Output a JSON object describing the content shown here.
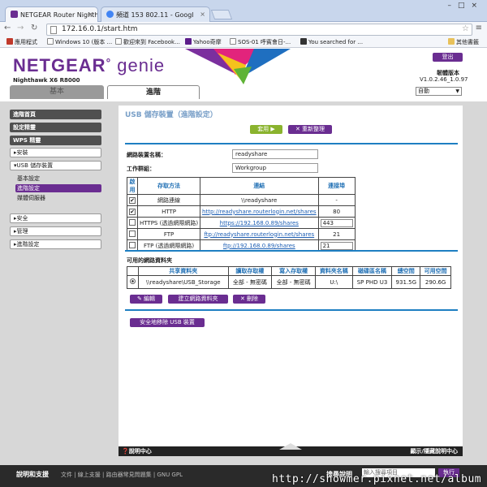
{
  "browser": {
    "tabs": [
      {
        "label": "NETGEAR Router Nighth",
        "active": true
      },
      {
        "label": "頻道 153 802.11 - Googl",
        "active": false
      }
    ],
    "url": "172.16.0.1/start.htm",
    "bookmarks": [
      "應用程式",
      "Windows 10 (版本 ...",
      "歡迎來到 Facebook...",
      "Yahoo奇摩",
      "SOS-01 呼賓會日-...",
      "You searched for ...",
      "其他書籤"
    ]
  },
  "header": {
    "brand": "NETGEAR",
    "product": "genie",
    "model": "Nighthawk X6 R8000",
    "logout_label": "登出",
    "firmware_label": "韌體版本",
    "firmware_version": "V1.0.2.46_1.0.97",
    "language": "自動"
  },
  "main_tabs": {
    "basic": "基本",
    "advanced": "進階"
  },
  "sidebar": {
    "dark_items": [
      "進階首頁",
      "設定精靈",
      "WPS 精靈"
    ],
    "setup": "▸安裝",
    "usb": "▾USB 儲存裝置",
    "usb_sub": [
      "基本設定",
      "進階設定",
      "媒體伺服器"
    ],
    "others": [
      "▸安全",
      "▸管理",
      "▸進階設定"
    ]
  },
  "panel": {
    "title": "USB 儲存裝置（進階設定）",
    "apply_label": "套用 ▶",
    "refresh_label": "✕ 重新整理",
    "device_name_label": "網路裝置名稱：",
    "device_name_value": "readyshare",
    "workgroup_label": "工作群組：",
    "workgroup_value": "Workgroup",
    "access_headers": [
      "啟用",
      "存取方法",
      "連結",
      "連接埠"
    ],
    "access_rows": [
      {
        "enabled": true,
        "method": "網路連線",
        "link": "\\\\readyshare",
        "port": "-",
        "link_is_url": false,
        "port_input": false
      },
      {
        "enabled": true,
        "method": "HTTP",
        "link": "http://readyshare.routerlogin.net/shares",
        "port": "80",
        "link_is_url": true,
        "port_input": false
      },
      {
        "enabled": false,
        "method": "HTTPS (透過網際網路)",
        "link": "https://192.168.0.89/shares",
        "port": "443",
        "link_is_url": true,
        "port_input": true
      },
      {
        "enabled": false,
        "method": "FTP",
        "link": "ftp://readyshare.routerlogin.net/shares",
        "port": "21",
        "link_is_url": true,
        "port_input": false
      },
      {
        "enabled": false,
        "method": "FTP (透過網際網路)",
        "link": "ftp://192.168.0.89/shares",
        "port": "21",
        "link_is_url": true,
        "port_input": true
      }
    ],
    "folders_label": "可用的網路資料夾",
    "folder_headers": [
      "共享資料夾",
      "讀取存取權",
      "寫入存取權",
      "資料夾名稱",
      "磁碟區名稱",
      "總空間",
      "可用空間"
    ],
    "folder_rows": [
      {
        "share": "\\\\readyshare\\USB_Storage",
        "read": "全部 - 無密碼",
        "write": "全部 - 無密碼",
        "folder": "U:\\",
        "volume": "SP PHD U3",
        "total": "931.5G",
        "free": "290.6G"
      }
    ],
    "edit_label": "✎ 編輯",
    "create_label": "建立網路資料夾",
    "delete_label": "✕ 刪除",
    "safe_remove_label": "安全地移除 USB 裝置"
  },
  "footer": {
    "help_center": "❓說明中心",
    "show_help": "顯示/隱藏說明中心",
    "support_label": "說明和支援",
    "support_links": "文件 | 線上支援 | 路由器常見問題集 | GNU GPL",
    "search_label": "搜尋說明",
    "search_placeholder": "輸入搜尋項目",
    "search_button": "執行"
  },
  "watermark": "http://showmer.pixnet.net/album"
}
